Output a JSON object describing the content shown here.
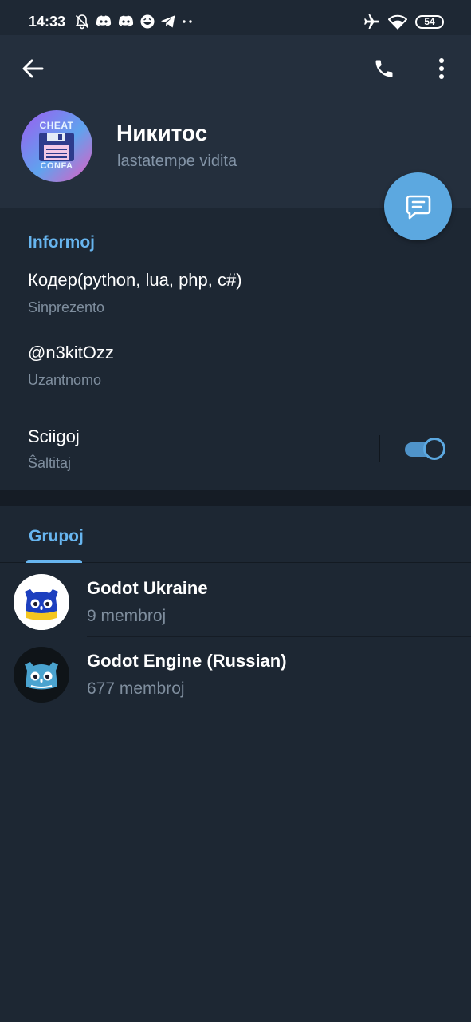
{
  "status_bar": {
    "time": "14:33",
    "battery": "54",
    "left_icons": [
      "mute-bell-icon",
      "discord-icon",
      "discord-icon",
      "emoji-icon",
      "telegram-icon",
      "more-dots-icon"
    ],
    "right_icons": [
      "airplane-icon",
      "wifi-icon",
      "battery-icon"
    ]
  },
  "header": {
    "back_icon": "arrow-left-icon",
    "call_icon": "phone-icon",
    "more_icon": "more-vertical-icon",
    "avatar_top_text": "CHEAT",
    "avatar_bottom_text": "CONFA",
    "name": "Никитос",
    "status": "lastatempe vidita"
  },
  "fab": {
    "icon": "message-icon"
  },
  "info": {
    "title": "Informoj",
    "bio": {
      "value": "Кодер(python, lua, php, c#)",
      "label": "Sinprezento"
    },
    "username": {
      "value": "@n3kitOzz",
      "label": "Uzantnomo"
    },
    "notifications": {
      "value": "Sciigoj",
      "label": "Ŝaltitaj",
      "enabled": true
    }
  },
  "groups": {
    "tab_label": "Grupoj",
    "items": [
      {
        "name": "Godot Ukraine",
        "members": "9 membroj"
      },
      {
        "name": "Godot Engine (Russian)",
        "members": "677 membroj"
      }
    ]
  },
  "colors": {
    "background": "#1d2733",
    "header": "#242f3d",
    "accent": "#67b5ef",
    "fab": "#5ca8e0",
    "secondary_text": "#7f8e9e"
  }
}
